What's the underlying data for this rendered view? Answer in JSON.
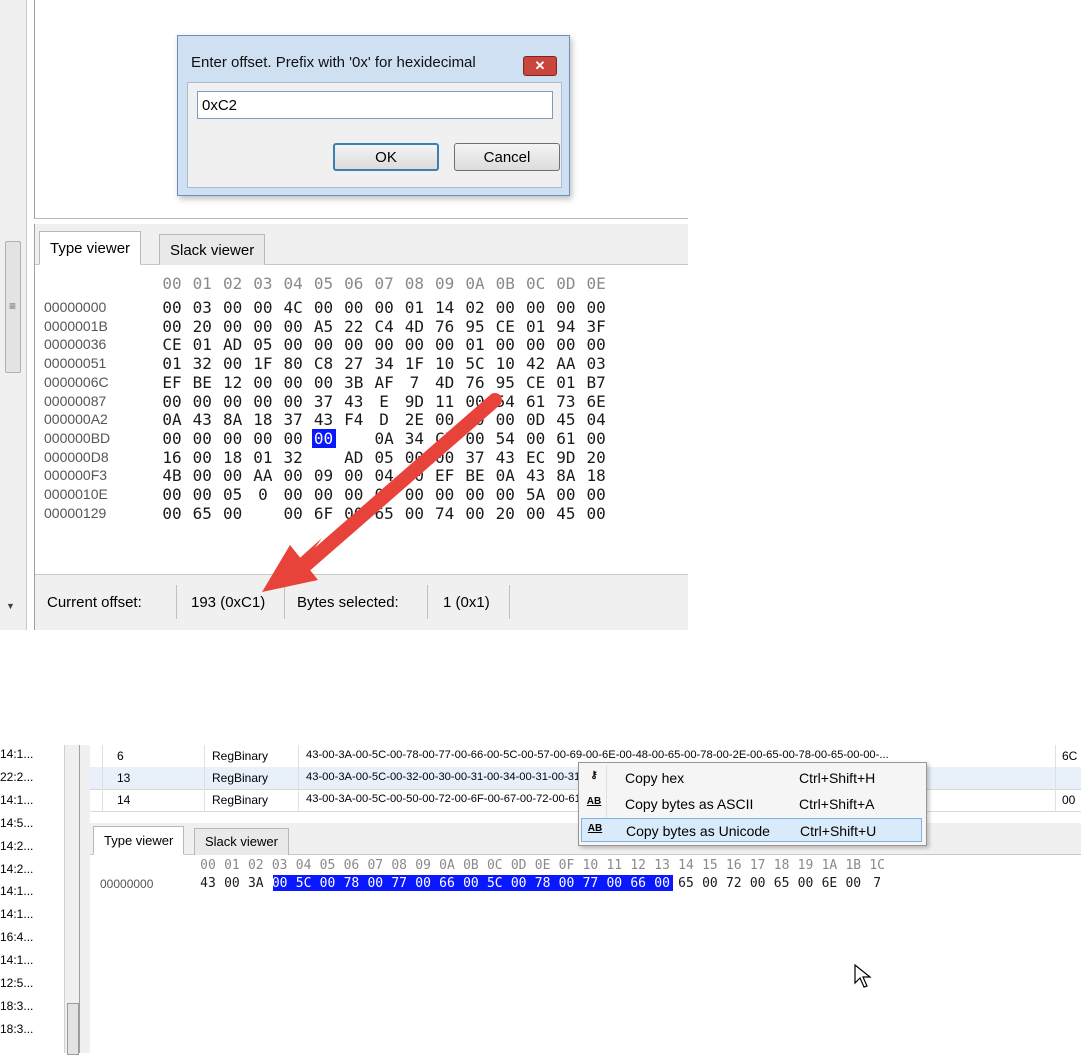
{
  "top_window": {
    "dialog": {
      "title": "Enter offset. Prefix with '0x' for hexidecimal",
      "close_label": "✕",
      "input_value": "0xC2",
      "ok_label": "OK",
      "cancel_label": "Cancel"
    },
    "tabs": [
      {
        "label": "Type viewer",
        "active": true
      },
      {
        "label": "Slack viewer",
        "active": false
      }
    ],
    "hex_header": [
      "00",
      "01",
      "02",
      "03",
      "04",
      "05",
      "06",
      "07",
      "08",
      "09",
      "0A",
      "0B",
      "0C",
      "0D",
      "0E"
    ],
    "hex_rows": [
      {
        "offset": "00000000",
        "bytes": [
          "00",
          "03",
          "00",
          "00",
          "4C",
          "00",
          "00",
          "00",
          "01",
          "14",
          "02",
          "00",
          "00",
          "00",
          "00"
        ]
      },
      {
        "offset": "0000001B",
        "bytes": [
          "00",
          "20",
          "00",
          "00",
          "00",
          "A5",
          "22",
          "C4",
          "4D",
          "76",
          "95",
          "CE",
          "01",
          "94",
          "3F"
        ]
      },
      {
        "offset": "00000036",
        "bytes": [
          "CE",
          "01",
          "AD",
          "05",
          "00",
          "00",
          "00",
          "00",
          "00",
          "00",
          "01",
          "00",
          "00",
          "00",
          "00"
        ]
      },
      {
        "offset": "00000051",
        "bytes": [
          "01",
          "32",
          "00",
          "1F",
          "80",
          "C8",
          "27",
          "34",
          "1F",
          "10",
          "5C",
          "10",
          "42",
          "AA",
          "03"
        ]
      },
      {
        "offset": "0000006C",
        "bytes": [
          "EF",
          "BE",
          "12",
          "00",
          "00",
          "00",
          "3B",
          "AF",
          "7",
          "4D",
          "76",
          "95",
          "CE",
          "01",
          "B7"
        ]
      },
      {
        "offset": "00000087",
        "bytes": [
          "00",
          "00",
          "00",
          "00",
          "00",
          "37",
          "43",
          "E",
          "9D",
          "11",
          "00",
          "54",
          "61",
          "73",
          "6E"
        ]
      },
      {
        "offset": "000000A2",
        "bytes": [
          "0A",
          "43",
          "8A",
          "18",
          "37",
          "43",
          "F4",
          "D",
          "2E",
          "00",
          "00",
          "00",
          "0D",
          "45",
          "04"
        ]
      },
      {
        "offset": "000000BD",
        "bytes": [
          "00",
          "00",
          "00",
          "00",
          "00",
          "00",
          "",
          "0A",
          "34",
          "C5",
          "00",
          "54",
          "00",
          "61",
          "00"
        ]
      },
      {
        "offset": "000000D8",
        "bytes": [
          "16",
          "00",
          "18",
          "01",
          "32",
          "",
          "AD",
          "05",
          "00",
          "00",
          "37",
          "43",
          "EC",
          "9D",
          "20"
        ]
      },
      {
        "offset": "000000F3",
        "bytes": [
          "4B",
          "00",
          "00",
          "AA",
          "00",
          "09",
          "00",
          "04",
          "00",
          "EF",
          "BE",
          "0A",
          "43",
          "8A",
          "18"
        ]
      },
      {
        "offset": "0000010E",
        "bytes": [
          "00",
          "00",
          "05",
          "0",
          "00",
          "00",
          "00",
          "00",
          "00",
          "00",
          "00",
          "00",
          "5A",
          "00",
          "00"
        ]
      },
      {
        "offset": "00000129",
        "bytes": [
          "00",
          "65",
          "00",
          "",
          "00",
          "6F",
          "00",
          "65",
          "00",
          "74",
          "00",
          "20",
          "00",
          "45",
          "00"
        ]
      }
    ],
    "selected_byte": {
      "row": 7,
      "col": 5
    },
    "status": {
      "offset_label": "Current offset:",
      "offset_value": "193 (0xC1)",
      "bytes_label": "Bytes selected:",
      "bytes_value": "1 (0x1)"
    },
    "arrow_color": "#e8433b"
  },
  "bottom_window": {
    "times": [
      "14:1...",
      "22:2...",
      "14:1...",
      "14:5...",
      "14:2...",
      "14:2...",
      "14:1...",
      "14:1...",
      "16:4...",
      "14:1...",
      "12:5...",
      "18:3...",
      "18:3..."
    ],
    "table_rows": [
      {
        "id": "6",
        "type": "RegBinary",
        "value": "43-00-3A-00-5C-00-78-00-77-00-66-00-5C-00-57-00-69-00-6E-00-48-00-65-00-78-00-2E-00-65-00-78-00-65-00-00-...",
        "extra": "6C"
      },
      {
        "id": "13",
        "type": "RegBinary",
        "value": "43-00-3A-00-5C-00-32-00-30-00-31-00-34-00-31-00-31-00-33-00-30-00-38-00-34-00-39-00-34-00-35-00-5F-...",
        "extra": ""
      },
      {
        "id": "14",
        "type": "RegBinary",
        "value": "43-00-3A-00-5C-00-50-00-72-00-6F-00-67-00-72-00-61-00-6D-00-20-00-46-00-69-00-6C-00-65-00-73-00-20-00-28-",
        "extra": "00"
      }
    ],
    "tabs": [
      {
        "label": "Type viewer",
        "active": true
      },
      {
        "label": "Slack viewer",
        "active": false
      }
    ],
    "hex_header": [
      "00",
      "01",
      "02",
      "03",
      "04",
      "05",
      "06",
      "07",
      "08",
      "09",
      "0A",
      "0B",
      "0C",
      "0D",
      "0E",
      "0F",
      "10",
      "11",
      "12",
      "13",
      "14",
      "15",
      "16",
      "17",
      "18",
      "19",
      "1A",
      "1B",
      "1C"
    ],
    "hex_row": {
      "offset": "00000000",
      "bytes": [
        "43",
        "00",
        "3A",
        "00",
        "5C",
        "00",
        "78",
        "00",
        "77",
        "00",
        "66",
        "00",
        "5C",
        "00",
        "78",
        "00",
        "77",
        "00",
        "66",
        "00",
        "65",
        "00",
        "72",
        "00",
        "65",
        "00",
        "6E",
        "00",
        "7"
      ],
      "selected_from": 3,
      "selected_to": 19
    },
    "context_menu": [
      {
        "icon": "key-icon",
        "label": "Copy hex",
        "shortcut": "Ctrl+Shift+H",
        "hover": false
      },
      {
        "icon": "ascii-icon",
        "label": "Copy bytes as ASCII",
        "shortcut": "Ctrl+Shift+A",
        "hover": false
      },
      {
        "icon": "unicode-icon",
        "label": "Copy bytes as Unicode",
        "shortcut": "Ctrl+Shift+U",
        "hover": true
      }
    ],
    "selection_color": "#0a18ff"
  }
}
